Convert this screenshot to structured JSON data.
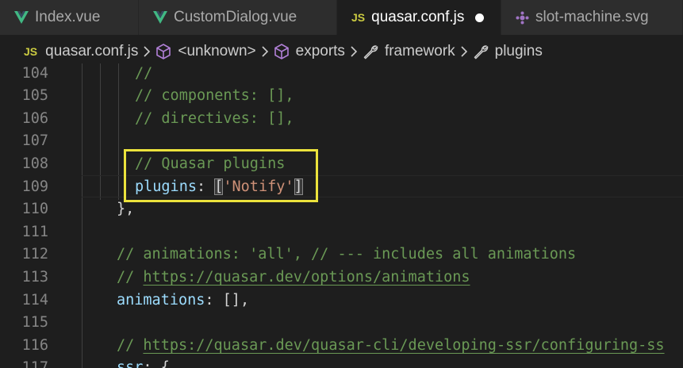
{
  "tabs": [
    {
      "label": "Index.vue",
      "icon": "vue-icon",
      "active": false,
      "modified": false
    },
    {
      "label": "CustomDialog.vue",
      "icon": "vue-icon",
      "active": false,
      "modified": false
    },
    {
      "label": "quasar.conf.js",
      "icon": "js-icon",
      "active": true,
      "modified": true
    },
    {
      "label": "slot-machine.svg",
      "icon": "svg-icon",
      "active": false,
      "modified": false
    }
  ],
  "tab_icon_text": {
    "js": "JS"
  },
  "breadcrumb": {
    "file": "quasar.conf.js",
    "file_icon": "JS",
    "items": [
      "<unknown>",
      "exports",
      "framework",
      "plugins"
    ]
  },
  "editor": {
    "lines": [
      {
        "num": "104",
        "parts": [
          [
            "cmt",
            "//"
          ]
        ]
      },
      {
        "num": "105",
        "parts": [
          [
            "cmt",
            "// components: [],"
          ]
        ]
      },
      {
        "num": "106",
        "parts": [
          [
            "cmt",
            "// directives: [],"
          ]
        ]
      },
      {
        "num": "107",
        "parts": []
      },
      {
        "num": "108",
        "parts": [
          [
            "cmt",
            "// Quasar plugins"
          ]
        ]
      },
      {
        "num": "109",
        "parts": [
          [
            "kw",
            "plugins"
          ],
          [
            "punc",
            ": "
          ],
          [
            "bm",
            "["
          ],
          [
            "str",
            "'Notify'"
          ],
          [
            "bm",
            "]"
          ]
        ]
      },
      {
        "num": "110",
        "parts": [
          [
            "punc",
            "},"
          ]
        ]
      },
      {
        "num": "111",
        "parts": []
      },
      {
        "num": "112",
        "parts": [
          [
            "cmt",
            "// animations: 'all', // --- includes all animations"
          ]
        ]
      },
      {
        "num": "113",
        "parts": [
          [
            "cmt",
            "// "
          ],
          [
            "url",
            "https://quasar.dev/options/animations"
          ]
        ]
      },
      {
        "num": "114",
        "parts": [
          [
            "kw",
            "animations"
          ],
          [
            "punc",
            ": [],"
          ]
        ]
      },
      {
        "num": "115",
        "parts": []
      },
      {
        "num": "116",
        "parts": [
          [
            "cmt",
            "// "
          ],
          [
            "url",
            "https://quasar.dev/quasar-cli/developing-ssr/configuring-ss"
          ]
        ]
      },
      {
        "num": "117",
        "parts": [
          [
            "kw",
            "ssr"
          ],
          [
            "punc",
            ": {"
          ]
        ]
      }
    ]
  },
  "colors": {
    "accent_highlight": "#ebe23c",
    "comment": "#6a9955",
    "property": "#9cdcfe",
    "string": "#ce9178"
  }
}
